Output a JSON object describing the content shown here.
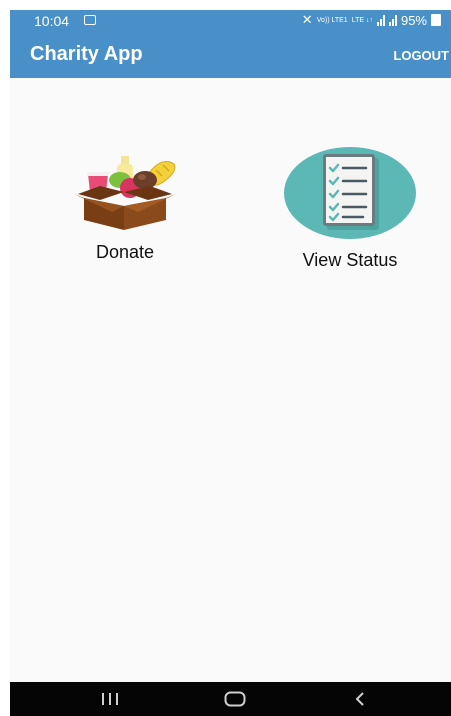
{
  "status_bar": {
    "time": "10:04",
    "network": [
      "Vo)) LTE1",
      "LTE ↓↑"
    ],
    "battery": "95%"
  },
  "app_bar": {
    "title": "Charity App",
    "logout_label": "LOGOUT"
  },
  "actions": [
    {
      "label": "Donate",
      "icon": "donation-box-icon"
    },
    {
      "label": "View Status",
      "icon": "checklist-icon"
    }
  ],
  "nav_bar": {
    "buttons": [
      "recent-apps-icon",
      "home-icon",
      "back-icon"
    ]
  },
  "colors": {
    "primary": "#4a90c8",
    "background": "#fafafa",
    "status_icon_circle": "#5bb8b4",
    "box_brown": "#7a3e14",
    "nav_bar": "#050505"
  }
}
